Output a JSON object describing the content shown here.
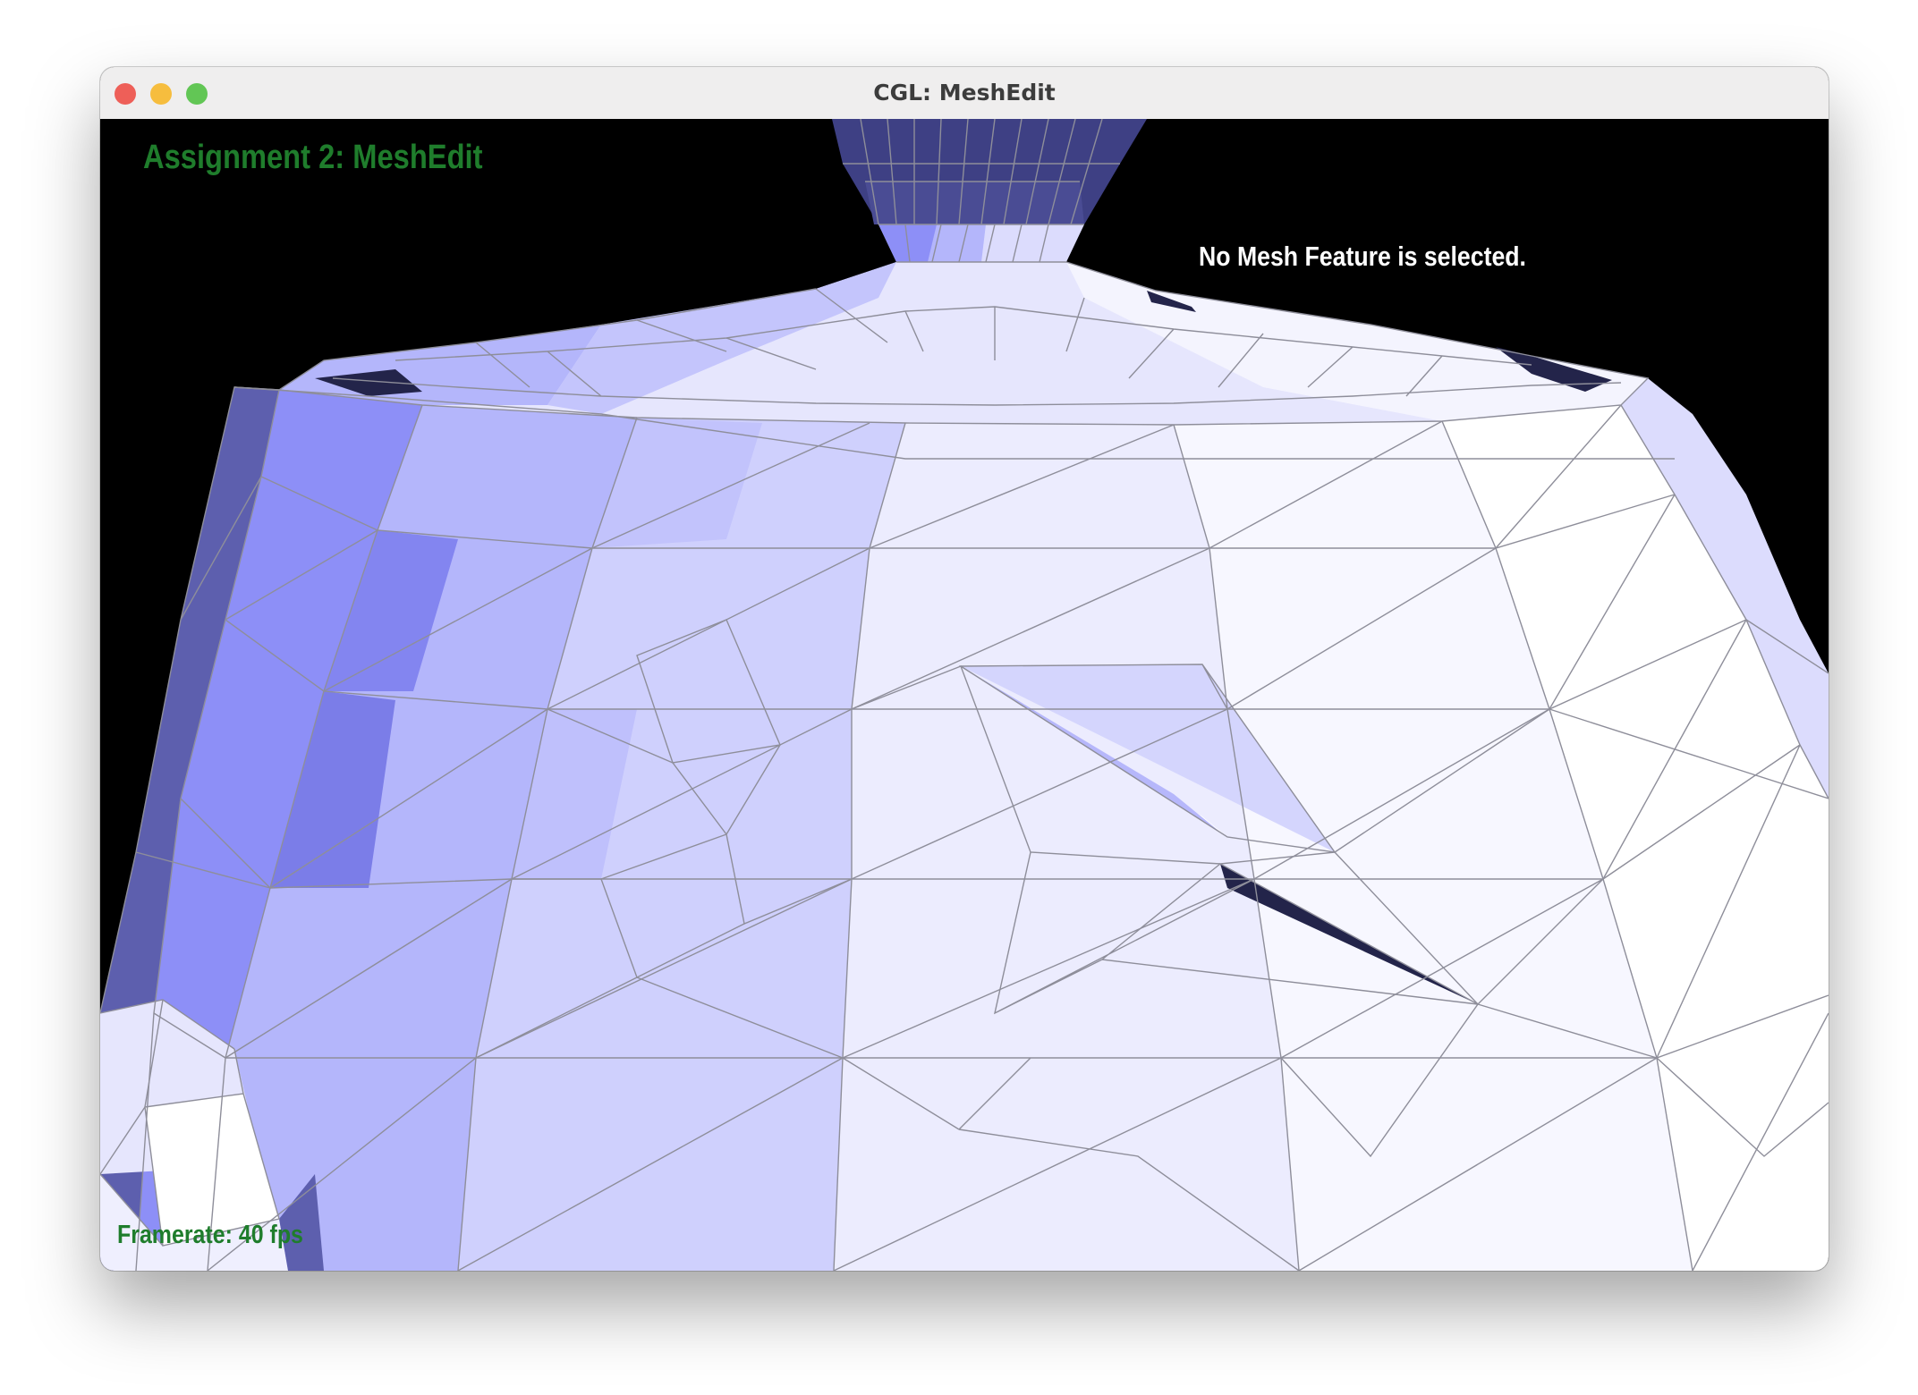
{
  "window": {
    "title": "CGL: MeshEdit"
  },
  "hud": {
    "title": "Assignment 2: MeshEdit",
    "selection_status": "No Mesh Feature is selected.",
    "framerate": "Framerate: 40 fps"
  },
  "viewport": {
    "background": "#000000",
    "mesh_fill_colors": [
      "#8d8ff7",
      "#b4b6fb",
      "#dcdcfd",
      "#ffffff"
    ],
    "wire_color": "#8e8e9a",
    "hole_color": "#23244a"
  }
}
